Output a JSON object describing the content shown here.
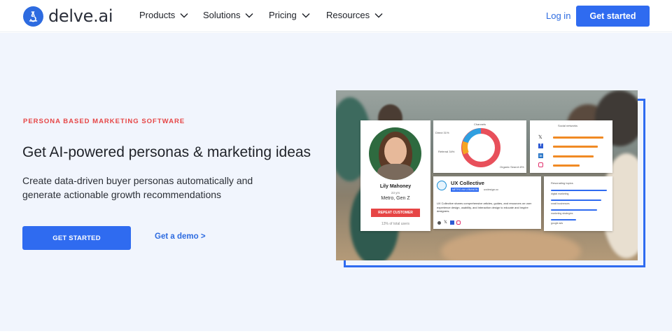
{
  "header": {
    "brand": "delve.ai",
    "nav": [
      {
        "label": "Products"
      },
      {
        "label": "Solutions"
      },
      {
        "label": "Pricing"
      },
      {
        "label": "Resources"
      }
    ],
    "login_label": "Log in",
    "cta_label": "Get started"
  },
  "hero": {
    "eyebrow": "PERSONA BASED MARKETING SOFTWARE",
    "headline": "Get AI-powered personas & marketing ideas",
    "subhead": "Create data-driven buyer personas automatically and generate actionable growth recommendations",
    "primary_button": "GET STARTED",
    "demo_link": "Get a demo >"
  },
  "persona_card": {
    "name": "Lily Mahoney",
    "age": "23 yrs",
    "segment": "Metro, Gen Z",
    "badge": "REPEAT CUSTOMER",
    "share": "13% of total users"
  },
  "channels_card": {
    "title": "Channels",
    "labels": [
      "Direct 31%",
      "Referral 34%",
      "Organic Search 8%"
    ]
  },
  "social_card": {
    "title": "Social networks"
  },
  "ux_card": {
    "title": "UX Collective",
    "tag": "METRO AM LEBANON",
    "url": "uxdesign.cc",
    "description": "UX Collective shares comprehensive articles, guides, and resources on user experience design, usability, and interaction design to educate and inspire designers."
  },
  "topics_card": {
    "title": "Resonating topics",
    "topics": [
      "digital marketing",
      "small businesses",
      "marketing strategies",
      "google ads"
    ]
  },
  "colors": {
    "brand_blue": "#2f6bf0",
    "accent_red": "#e64545",
    "hero_bg": "#f1f5fd"
  }
}
